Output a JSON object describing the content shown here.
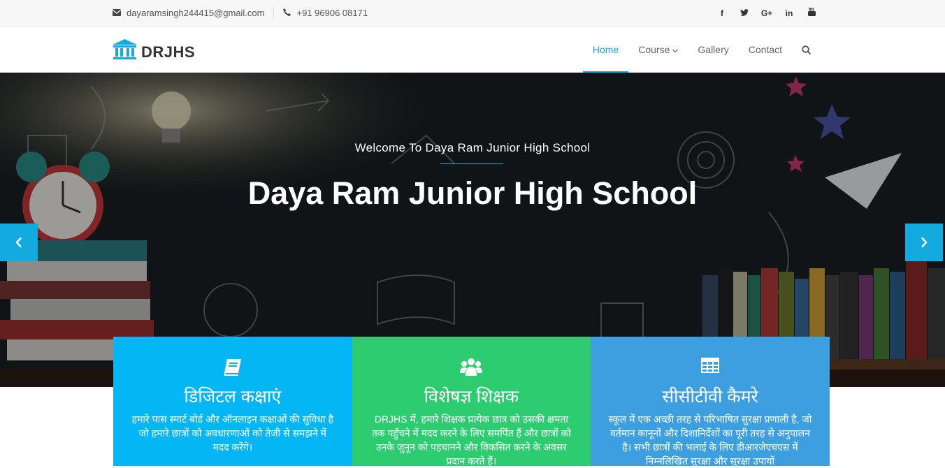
{
  "topbar": {
    "email": "dayaramsingh244415@gmail.com",
    "phone": "+91 96906 08171",
    "social": [
      "facebook-icon",
      "twitter-icon",
      "google-plus-icon",
      "linkedin-icon",
      "youtube-icon"
    ],
    "social_glyphs": {
      "facebook": "f",
      "twitter": "t",
      "google": "G+",
      "linkedin": "in",
      "youtube": "▶"
    }
  },
  "brand": {
    "name": "DRJHS",
    "icon": "institution-icon"
  },
  "nav": {
    "home": "Home",
    "course": "Course",
    "gallery": "Gallery",
    "contact": "Contact",
    "search_icon": "search-icon"
  },
  "hero": {
    "subtitle": "Welcome To Daya Ram Junior High School",
    "title": "Daya Ram Junior High School"
  },
  "features": [
    {
      "icon": "book-icon",
      "title": "डिजिटल कक्षाएं",
      "text": "हमारे पास स्मार्ट बोर्ड और ऑनलाइन कक्षाओं की सुविधा है जो हमारे छात्रों को अवधारणाओं को तेजी से समझने में मदद करेंगे।",
      "color": "#05b6f5"
    },
    {
      "icon": "users-icon",
      "title": "विशेषज्ञ शिक्षक",
      "text": "DRJHS में, हमारे शिक्षक प्रत्येक छात्र को उसकी क्षमता तक पहुँचने में मदद करने के लिए समर्पित हैं और छात्रों को उनके जुनून को पहचानने और विकसित करने के अवसर प्रदान करते हैं।",
      "color": "#2ecc71"
    },
    {
      "icon": "table-icon",
      "title": "सीसीटीवी कैमरे",
      "text": "स्कूल में एक अच्छी तरह से परिभाषित सुरक्षा प्रणाली है, जो वर्तमान कानूनों और दिशानिर्देशों का पूरी तरह से अनुपालन है। सभी छात्रों की भलाई के लिए डीआरजेएचएस में निम्नलिखित सुरक्षा और सुरक्षा उपायों",
      "color": "#3e9fe0"
    }
  ],
  "colors": {
    "accent": "#12aadf"
  }
}
